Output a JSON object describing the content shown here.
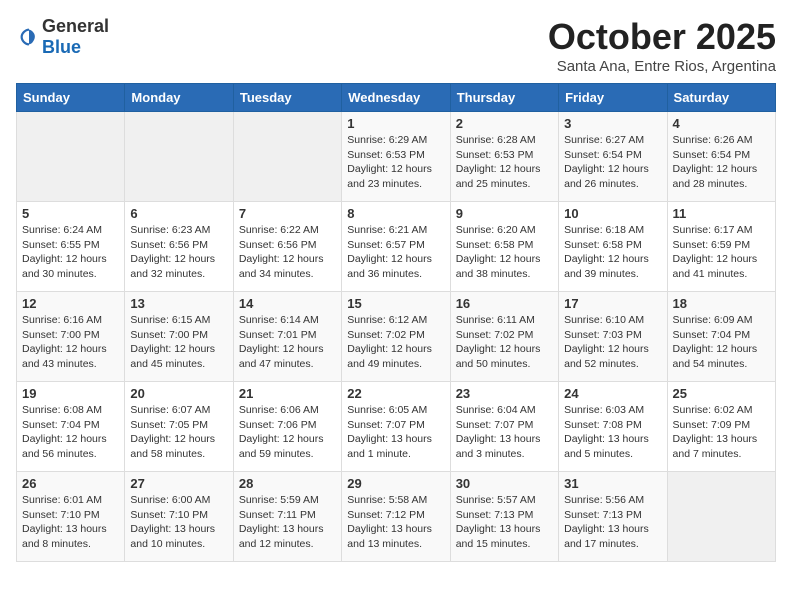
{
  "logo": {
    "general": "General",
    "blue": "Blue"
  },
  "header": {
    "title": "October 2025",
    "subtitle": "Santa Ana, Entre Rios, Argentina"
  },
  "weekdays": [
    "Sunday",
    "Monday",
    "Tuesday",
    "Wednesday",
    "Thursday",
    "Friday",
    "Saturday"
  ],
  "weeks": [
    [
      {
        "day": "",
        "info": ""
      },
      {
        "day": "",
        "info": ""
      },
      {
        "day": "",
        "info": ""
      },
      {
        "day": "1",
        "info": "Sunrise: 6:29 AM\nSunset: 6:53 PM\nDaylight: 12 hours\nand 23 minutes."
      },
      {
        "day": "2",
        "info": "Sunrise: 6:28 AM\nSunset: 6:53 PM\nDaylight: 12 hours\nand 25 minutes."
      },
      {
        "day": "3",
        "info": "Sunrise: 6:27 AM\nSunset: 6:54 PM\nDaylight: 12 hours\nand 26 minutes."
      },
      {
        "day": "4",
        "info": "Sunrise: 6:26 AM\nSunset: 6:54 PM\nDaylight: 12 hours\nand 28 minutes."
      }
    ],
    [
      {
        "day": "5",
        "info": "Sunrise: 6:24 AM\nSunset: 6:55 PM\nDaylight: 12 hours\nand 30 minutes."
      },
      {
        "day": "6",
        "info": "Sunrise: 6:23 AM\nSunset: 6:56 PM\nDaylight: 12 hours\nand 32 minutes."
      },
      {
        "day": "7",
        "info": "Sunrise: 6:22 AM\nSunset: 6:56 PM\nDaylight: 12 hours\nand 34 minutes."
      },
      {
        "day": "8",
        "info": "Sunrise: 6:21 AM\nSunset: 6:57 PM\nDaylight: 12 hours\nand 36 minutes."
      },
      {
        "day": "9",
        "info": "Sunrise: 6:20 AM\nSunset: 6:58 PM\nDaylight: 12 hours\nand 38 minutes."
      },
      {
        "day": "10",
        "info": "Sunrise: 6:18 AM\nSunset: 6:58 PM\nDaylight: 12 hours\nand 39 minutes."
      },
      {
        "day": "11",
        "info": "Sunrise: 6:17 AM\nSunset: 6:59 PM\nDaylight: 12 hours\nand 41 minutes."
      }
    ],
    [
      {
        "day": "12",
        "info": "Sunrise: 6:16 AM\nSunset: 7:00 PM\nDaylight: 12 hours\nand 43 minutes."
      },
      {
        "day": "13",
        "info": "Sunrise: 6:15 AM\nSunset: 7:00 PM\nDaylight: 12 hours\nand 45 minutes."
      },
      {
        "day": "14",
        "info": "Sunrise: 6:14 AM\nSunset: 7:01 PM\nDaylight: 12 hours\nand 47 minutes."
      },
      {
        "day": "15",
        "info": "Sunrise: 6:12 AM\nSunset: 7:02 PM\nDaylight: 12 hours\nand 49 minutes."
      },
      {
        "day": "16",
        "info": "Sunrise: 6:11 AM\nSunset: 7:02 PM\nDaylight: 12 hours\nand 50 minutes."
      },
      {
        "day": "17",
        "info": "Sunrise: 6:10 AM\nSunset: 7:03 PM\nDaylight: 12 hours\nand 52 minutes."
      },
      {
        "day": "18",
        "info": "Sunrise: 6:09 AM\nSunset: 7:04 PM\nDaylight: 12 hours\nand 54 minutes."
      }
    ],
    [
      {
        "day": "19",
        "info": "Sunrise: 6:08 AM\nSunset: 7:04 PM\nDaylight: 12 hours\nand 56 minutes."
      },
      {
        "day": "20",
        "info": "Sunrise: 6:07 AM\nSunset: 7:05 PM\nDaylight: 12 hours\nand 58 minutes."
      },
      {
        "day": "21",
        "info": "Sunrise: 6:06 AM\nSunset: 7:06 PM\nDaylight: 12 hours\nand 59 minutes."
      },
      {
        "day": "22",
        "info": "Sunrise: 6:05 AM\nSunset: 7:07 PM\nDaylight: 13 hours\nand 1 minute."
      },
      {
        "day": "23",
        "info": "Sunrise: 6:04 AM\nSunset: 7:07 PM\nDaylight: 13 hours\nand 3 minutes."
      },
      {
        "day": "24",
        "info": "Sunrise: 6:03 AM\nSunset: 7:08 PM\nDaylight: 13 hours\nand 5 minutes."
      },
      {
        "day": "25",
        "info": "Sunrise: 6:02 AM\nSunset: 7:09 PM\nDaylight: 13 hours\nand 7 minutes."
      }
    ],
    [
      {
        "day": "26",
        "info": "Sunrise: 6:01 AM\nSunset: 7:10 PM\nDaylight: 13 hours\nand 8 minutes."
      },
      {
        "day": "27",
        "info": "Sunrise: 6:00 AM\nSunset: 7:10 PM\nDaylight: 13 hours\nand 10 minutes."
      },
      {
        "day": "28",
        "info": "Sunrise: 5:59 AM\nSunset: 7:11 PM\nDaylight: 13 hours\nand 12 minutes."
      },
      {
        "day": "29",
        "info": "Sunrise: 5:58 AM\nSunset: 7:12 PM\nDaylight: 13 hours\nand 13 minutes."
      },
      {
        "day": "30",
        "info": "Sunrise: 5:57 AM\nSunset: 7:13 PM\nDaylight: 13 hours\nand 15 minutes."
      },
      {
        "day": "31",
        "info": "Sunrise: 5:56 AM\nSunset: 7:13 PM\nDaylight: 13 hours\nand 17 minutes."
      },
      {
        "day": "",
        "info": ""
      }
    ]
  ]
}
